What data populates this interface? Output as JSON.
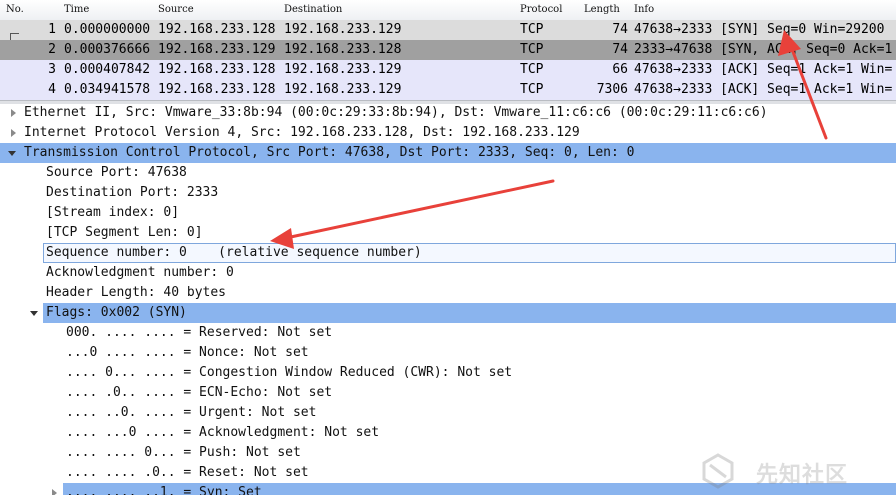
{
  "packet_list": {
    "columns": [
      "No.",
      "Time",
      "Source",
      "Destination",
      "Protocol",
      "Length",
      "Info"
    ],
    "rows": [
      {
        "no": "1",
        "time": "0.000000000",
        "source": "192.168.233.128",
        "destination": "192.168.233.129",
        "protocol": "TCP",
        "length": "74",
        "info": "47638→2333 [SYN] Seq=0 Win=29200"
      },
      {
        "no": "2",
        "time": "0.000376666",
        "source": "192.168.233.129",
        "destination": "192.168.233.128",
        "protocol": "TCP",
        "length": "74",
        "info": "2333→47638 [SYN, ACK] Seq=0 Ack=1"
      },
      {
        "no": "3",
        "time": "0.000407842",
        "source": "192.168.233.128",
        "destination": "192.168.233.129",
        "protocol": "TCP",
        "length": "66",
        "info": "47638→2333 [ACK] Seq=1 Ack=1 Win="
      },
      {
        "no": "4",
        "time": "0.034941578",
        "source": "192.168.233.128",
        "destination": "192.168.233.129",
        "protocol": "TCP",
        "length": "7306",
        "info": "47638→2333 [ACK] Seq=1 Ack=1 Win="
      }
    ]
  },
  "details": {
    "ethernet": "Ethernet II, Src: Vmware_33:8b:94 (00:0c:29:33:8b:94), Dst: Vmware_11:c6:c6 (00:0c:29:11:c6:c6)",
    "ip": "Internet Protocol Version 4, Src: 192.168.233.128, Dst: 192.168.233.129",
    "tcp": "Transmission Control Protocol, Src Port: 47638, Dst Port: 2333, Seq: 0, Len: 0",
    "tcp_fields": [
      "Source Port: 47638",
      "Destination Port: 2333",
      "[Stream index: 0]",
      "[TCP Segment Len: 0]",
      "Sequence number: 0    (relative sequence number)",
      "Acknowledgment number: 0",
      "Header Length: 40 bytes"
    ],
    "flags": "Flags: 0x002 (SYN)",
    "flag_bits": [
      "000. .... .... = Reserved: Not set",
      "...0 .... .... = Nonce: Not set",
      ".... 0... .... = Congestion Window Reduced (CWR): Not set",
      ".... .0.. .... = ECN-Echo: Not set",
      ".... ..0. .... = Urgent: Not set",
      ".... ...0 .... = Acknowledgment: Not set",
      ".... .... 0... = Push: Not set",
      ".... .... .0.. = Reset: Not set",
      ".... .... ..1. = Syn: Set"
    ]
  },
  "watermark": {
    "text": "先知社区"
  },
  "colors": {
    "selection": "#8ab4ee",
    "arrow": "#e8413a",
    "row_gray": "#a0a0a0",
    "row_lavender": "#e6e6fa"
  }
}
